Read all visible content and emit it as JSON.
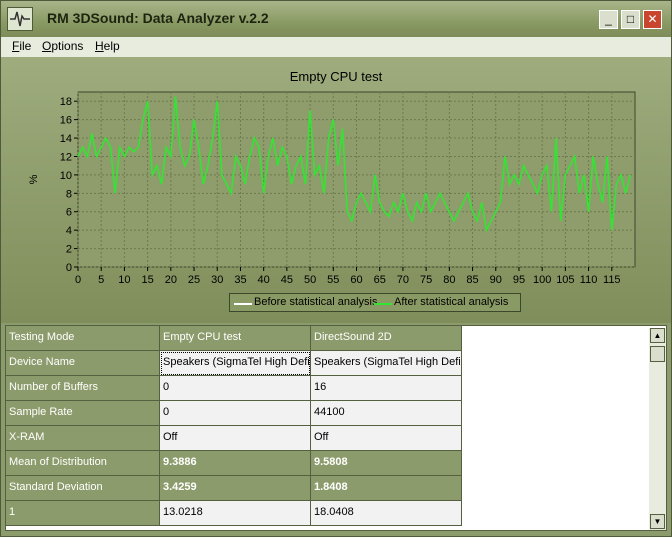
{
  "window": {
    "title": "RM 3DSound: Data Analyzer  v.2.2",
    "minimize_glyph": "_",
    "maximize_glyph": "□",
    "close_glyph": "✕"
  },
  "menu": {
    "file": "File",
    "options": "Options",
    "help": "Help"
  },
  "chart_data": {
    "type": "line",
    "title": "Empty CPU test",
    "ylabel": "%",
    "xlabel": "",
    "xlim": [
      0,
      120
    ],
    "ylim": [
      0,
      19
    ],
    "x_ticks": [
      0,
      5,
      10,
      15,
      20,
      25,
      30,
      35,
      40,
      45,
      50,
      55,
      60,
      65,
      70,
      75,
      80,
      85,
      90,
      95,
      100,
      105,
      110,
      115
    ],
    "y_ticks": [
      0,
      2,
      4,
      6,
      8,
      10,
      12,
      14,
      16,
      18
    ],
    "grid": true,
    "legend": "bottom-center",
    "series": [
      {
        "name": "Before statistical analysis",
        "color": "#ffffff",
        "values": []
      },
      {
        "name": "After statistical analysis",
        "color": "#33e533",
        "values": [
          12,
          13,
          12,
          14.5,
          12,
          13,
          14,
          13,
          8,
          13,
          12,
          13,
          12.5,
          13,
          16,
          18,
          10,
          11,
          9,
          13,
          12,
          18.5,
          13,
          11,
          12,
          16,
          13,
          9,
          11,
          14,
          18,
          10,
          9,
          8,
          12,
          11,
          9,
          12,
          14,
          13,
          8,
          12,
          14,
          11,
          13,
          12,
          9,
          11,
          12,
          9,
          17,
          10,
          11,
          8,
          14,
          16,
          11,
          15,
          6,
          5,
          7,
          8,
          7,
          6,
          10,
          7,
          6,
          5.5,
          7,
          6,
          8,
          6,
          5,
          7,
          6,
          8,
          6,
          7,
          8,
          7,
          6,
          5,
          6,
          7,
          8,
          6,
          5,
          7,
          4,
          5,
          6,
          7,
          12,
          9,
          10,
          9,
          11,
          10,
          9,
          8,
          10,
          11,
          6,
          14,
          5,
          10,
          11,
          12,
          8,
          10,
          6,
          12,
          9,
          7,
          12,
          4,
          9,
          10,
          8,
          10
        ]
      }
    ]
  },
  "table": {
    "rows": [
      {
        "label": "Testing Mode",
        "v1": "Empty CPU test",
        "v2": "DirectSound 2D"
      },
      {
        "label": "Device Name",
        "v1": "Speakers (SigmaTel High Definition Audio)",
        "v2": "Speakers (SigmaTel High Definition Audio)"
      },
      {
        "label": "Number of Buffers",
        "v1": "0",
        "v2": "16"
      },
      {
        "label": "Sample Rate",
        "v1": "0",
        "v2": "44100"
      },
      {
        "label": "X-RAM",
        "v1": "Off",
        "v2": "Off"
      },
      {
        "label": "Mean of Distribution",
        "v1": "9.3886",
        "v2": "9.5808"
      },
      {
        "label": "Standard Deviation",
        "v1": "3.4259",
        "v2": "1.8408"
      },
      {
        "label": "1",
        "v1": "13.0218",
        "v2": "18.0408"
      }
    ]
  },
  "scrollbar": {
    "up_glyph": "▲",
    "down_glyph": "▼"
  }
}
